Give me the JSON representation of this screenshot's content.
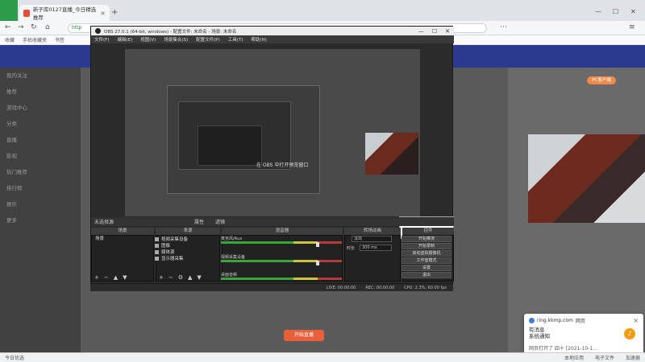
{
  "browser": {
    "tab_title": "新子库0127直播_今日精选推荐",
    "bookmarks": [
      "收藏",
      "手机收藏夹",
      "书签"
    ],
    "url_partial": "http",
    "status": {
      "left": "今日优选",
      "items": [
        "本地应用",
        "电子文件",
        "加速器"
      ]
    }
  },
  "obs": {
    "title": "OBS 27.0.1 (64-bit, windows) - 配置文件: 未命名 - 场景: 未命名",
    "menu": [
      "文件(F)",
      "编辑(E)",
      "视图(V)",
      "场景集合(S)",
      "配置文件(P)",
      "工具(T)",
      "帮助(H)"
    ],
    "preview_msg": "在 OBS 中打开预览窗口",
    "bar": {
      "label": "未选择源",
      "props": "属性",
      "filter": "滤镜"
    },
    "docks": {
      "scenes": "场景",
      "sources": "来源",
      "mixer": "混音器",
      "transitions": "转场动画",
      "controls": "控件"
    },
    "scene_items": [
      "场景"
    ],
    "sources": [
      "视频采集设备",
      "图像",
      "媒体源",
      "显示器采集"
    ],
    "mixer": [
      "麦克风/Aux",
      "视频采集设备",
      "桌面音频"
    ],
    "transition": {
      "type": "淡出",
      "duration_label": "时长",
      "duration": "300 ms"
    },
    "controls": [
      "开始推流",
      "开始录制",
      "启动虚拟摄像机",
      "工作室模式",
      "设置",
      "退出"
    ],
    "status": {
      "live": "LIVE: 00:00:00",
      "rec": "REC: 00:00:00",
      "cpu": "CPU: 2.3%, 60.00 fps"
    }
  },
  "site": {
    "sidebar": [
      "我的关注",
      "推荐",
      "游戏中心",
      "分类",
      "直播",
      "影视",
      "热门推荐",
      "排行榜",
      "娱乐",
      "更多"
    ],
    "pc_button": "PC客户端",
    "live_button": "开始直播"
  },
  "notification": {
    "site": "ring.kkmp.com",
    "tag": "网页",
    "title": "有消息",
    "body": "系统通知",
    "sub": "网页打开了  四十  [2021-10-1..."
  }
}
